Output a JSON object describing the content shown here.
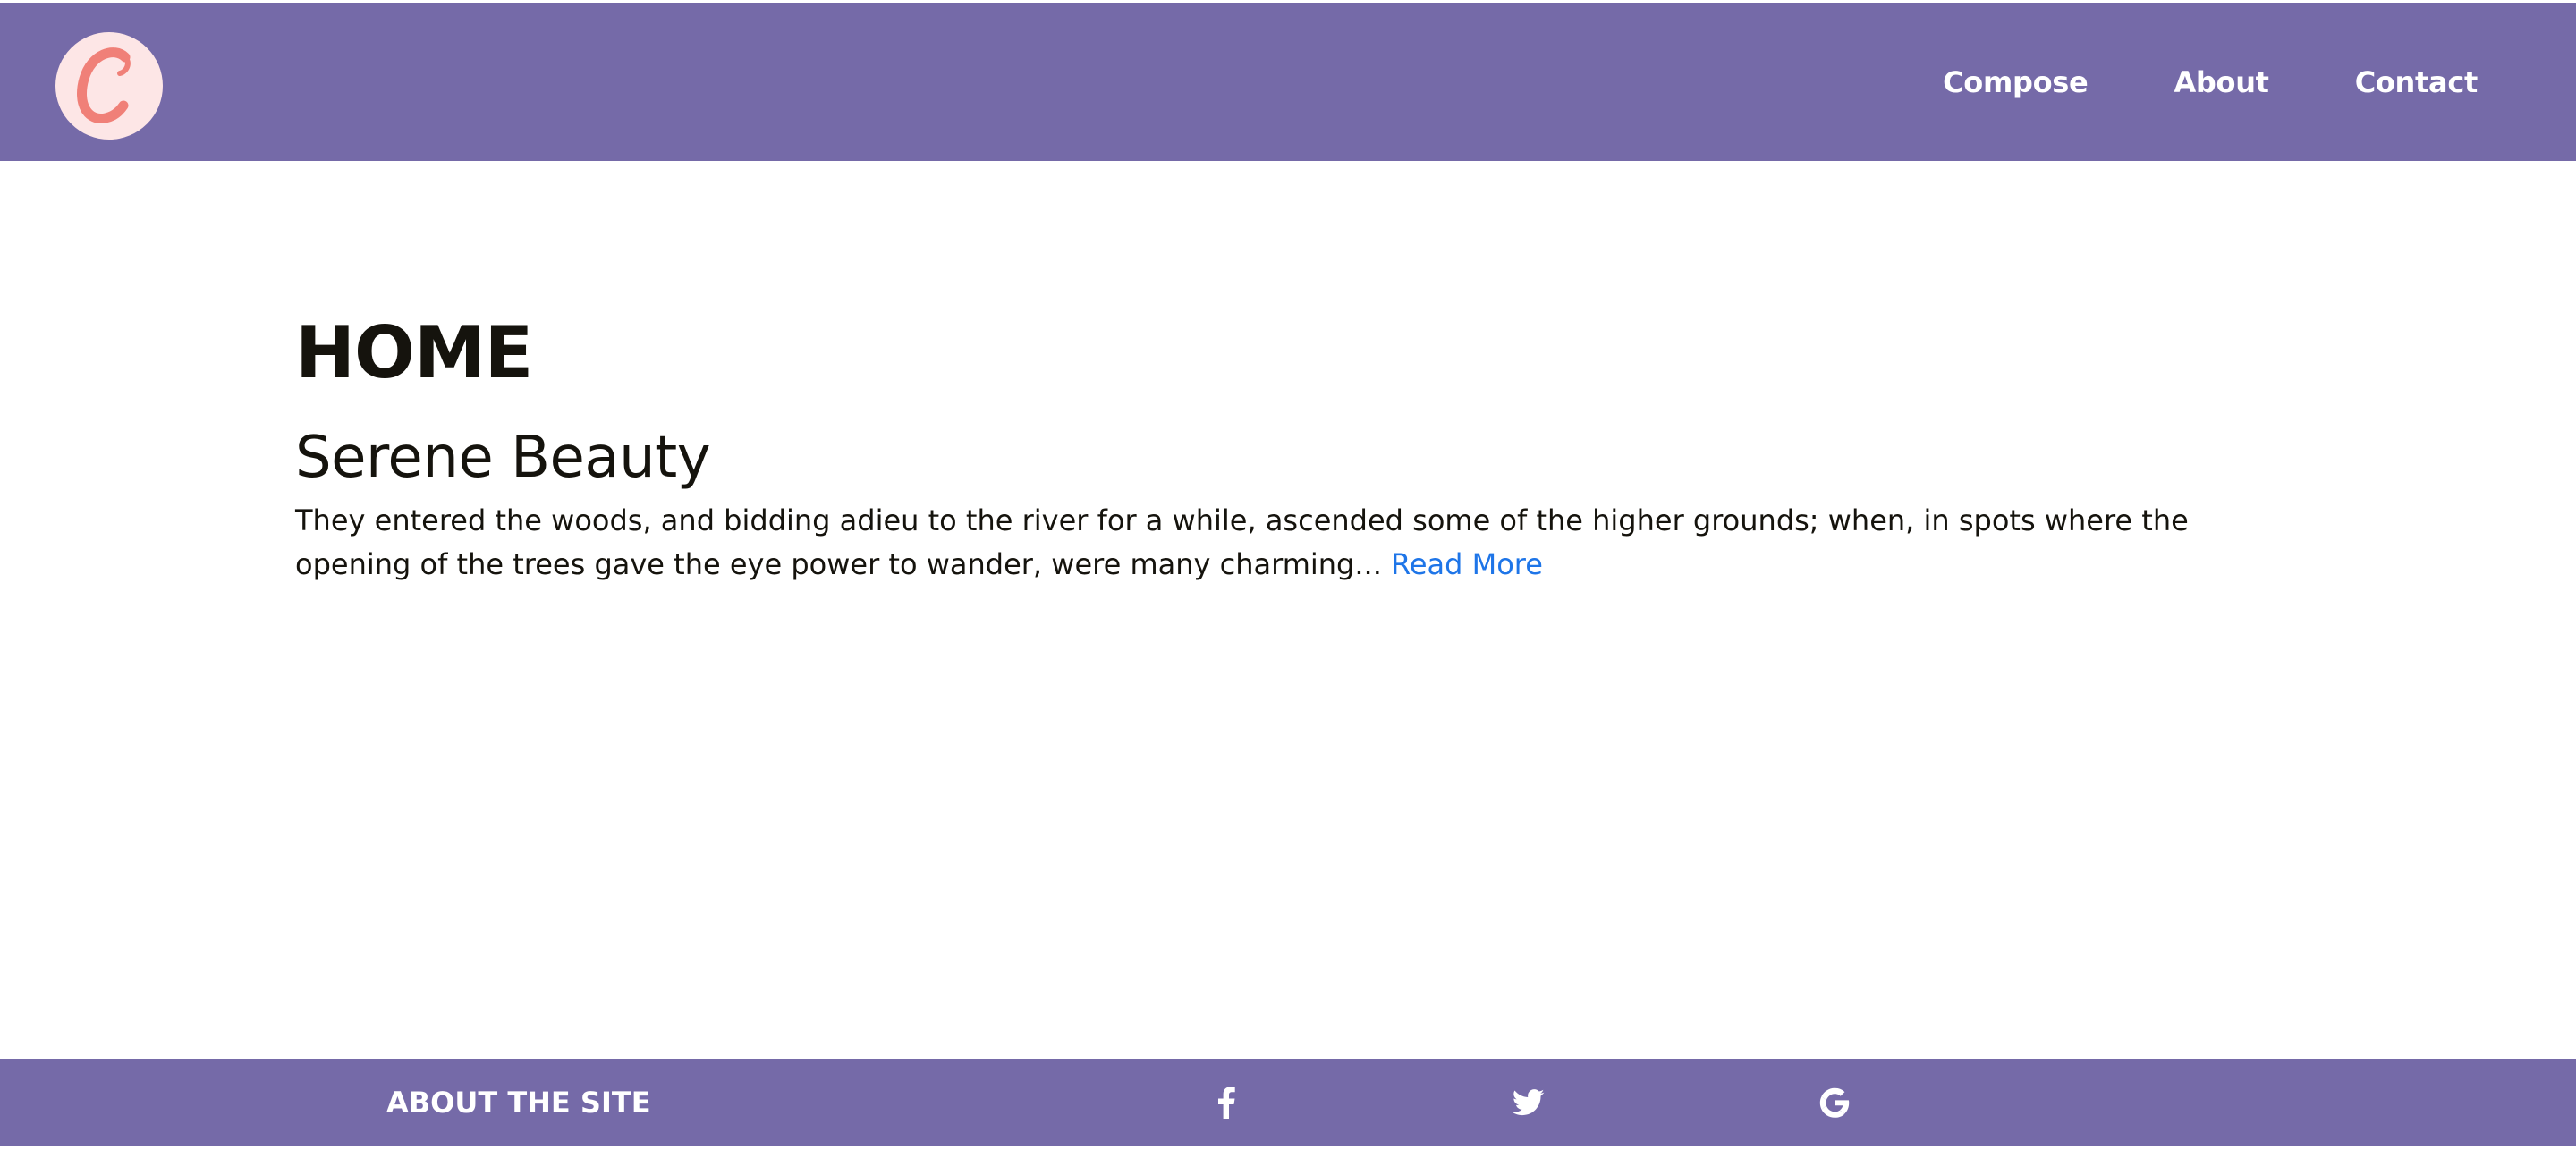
{
  "header": {
    "logo_letter": "C",
    "logo_icon": "cursive-c-logo-icon",
    "nav": [
      {
        "label": "Compose"
      },
      {
        "label": "About"
      },
      {
        "label": "Contact"
      }
    ]
  },
  "main": {
    "page_title": "HOME",
    "posts": [
      {
        "title": "Serene Beauty",
        "excerpt": "They entered the woods, and bidding adieu to the river for a while, ascended some of the higher grounds; when, in spots where the opening of the trees gave the eye power to wander, were many charming...",
        "read_more": "Read More"
      }
    ]
  },
  "footer": {
    "about_label": "ABOUT THE SITE",
    "social_icons": [
      "facebook-icon",
      "twitter-icon",
      "google-icon"
    ]
  },
  "colors": {
    "brand_purple": "#756aa8",
    "logo_bg": "#fde6e6",
    "logo_letter": "#f08078",
    "link_blue": "#1e75e8",
    "text_dark": "#15130d"
  }
}
